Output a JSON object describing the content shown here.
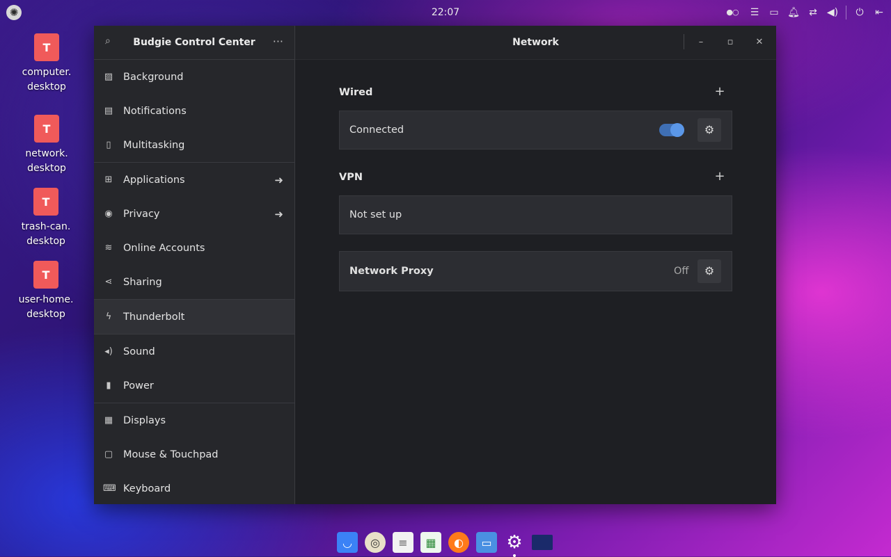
{
  "top_panel": {
    "clock": "22:07",
    "icons": [
      "workspace-dots-icon",
      "menu-lines-icon",
      "folder-icon",
      "bell-icon",
      "network-arrows-icon",
      "volume-icon",
      "power-icon",
      "logout-icon"
    ]
  },
  "desktop": {
    "icons": [
      {
        "label": "computer.\ndesktop"
      },
      {
        "label": "network.\ndesktop"
      },
      {
        "label": "trash-can.\ndesktop"
      },
      {
        "label": "user-home.\ndesktop"
      }
    ]
  },
  "window": {
    "sidebar_title": "Budgie Control Center",
    "main_title": "Network",
    "sidebar_items": [
      {
        "label": "Background",
        "icon": "background-icon"
      },
      {
        "label": "Notifications",
        "icon": "notifications-icon"
      },
      {
        "label": "Multitasking",
        "icon": "multitasking-icon"
      },
      {
        "label": "Applications",
        "icon": "applications-icon"
      },
      {
        "label": "Privacy",
        "icon": "privacy-icon"
      },
      {
        "label": "Online Accounts",
        "icon": "online-accounts-icon"
      },
      {
        "label": "Sharing",
        "icon": "sharing-icon"
      },
      {
        "label": "Thunderbolt",
        "icon": "thunderbolt-icon"
      },
      {
        "label": "Sound",
        "icon": "sound-icon"
      },
      {
        "label": "Power",
        "icon": "power-icon"
      },
      {
        "label": "Displays",
        "icon": "displays-icon"
      },
      {
        "label": "Mouse & Touchpad",
        "icon": "mouse-icon"
      },
      {
        "label": "Keyboard",
        "icon": "keyboard-icon"
      }
    ],
    "wired": {
      "title": "Wired",
      "status": "Connected",
      "toggle_on": true
    },
    "vpn": {
      "title": "VPN",
      "status": "Not set up"
    },
    "proxy": {
      "title": "Network Proxy",
      "status": "Off"
    }
  },
  "colors": {
    "accent": "#5b97e8",
    "desktop_icon": "#f05a5a"
  },
  "dock": {
    "items": [
      "store-icon",
      "rhythmbox-icon",
      "text-editor-icon",
      "spreadsheet-icon",
      "firefox-icon",
      "files-icon",
      "settings-icon",
      "display-icon"
    ]
  }
}
